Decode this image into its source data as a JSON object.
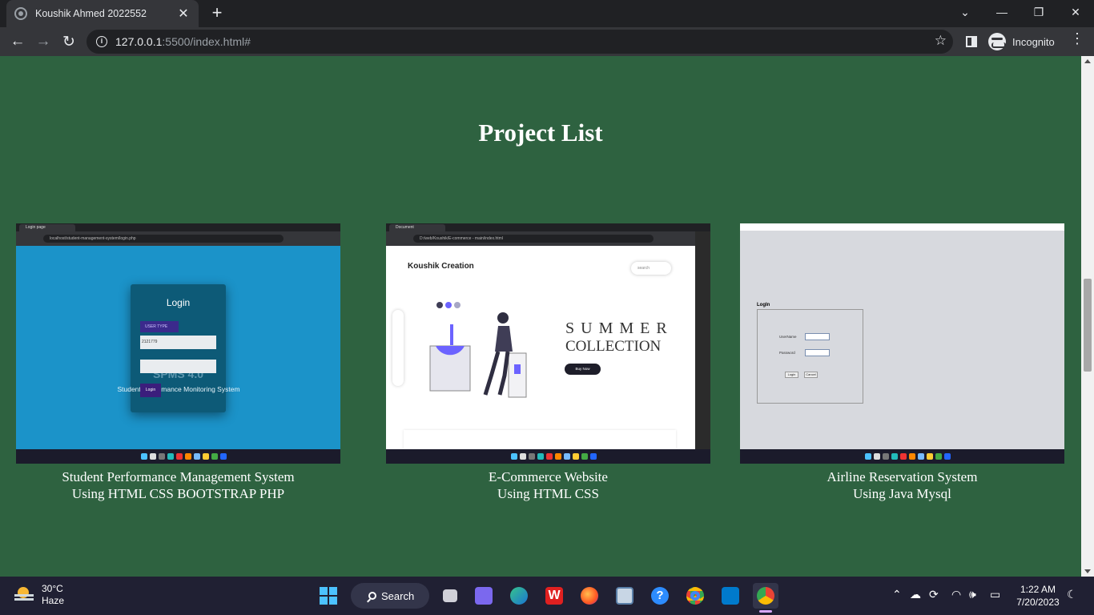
{
  "browser": {
    "tab_title": "Koushik Ahmed 2022552",
    "tab_close": "✕",
    "new_tab": "+",
    "url_host": "127.0.0.1",
    "url_path": ":5500/index.html#",
    "profile_label": "Incognito",
    "icons": [
      "back-icon",
      "forward-icon",
      "reload-icon",
      "info-icon",
      "star-icon",
      "side-panel-icon",
      "incognito-icon",
      "menu-icon"
    ]
  },
  "page": {
    "heading": "Project List",
    "projects": [
      {
        "title": "Student Performance Management System",
        "subtitle": "Using HTML CSS BOOTSTRAP PHP"
      },
      {
        "title": "E-Commerce Website",
        "subtitle": "Using HTML CSS"
      },
      {
        "title": "Airline Reservation System",
        "subtitle": "Using Java Mysql"
      }
    ]
  },
  "thumbnails": {
    "spms": {
      "tab": "Login page",
      "url": "localhost/student-management-system/login.php",
      "login_title": "Login",
      "user_type": "USER TYPE",
      "id_value": "2121779",
      "watermark": "SPMS 4.0",
      "subtitle": "Student Performance Monitoring System",
      "login_button": "Login"
    },
    "ecom": {
      "tab": "Document",
      "url": "D:/web/Koushik/E-commerce - main/index.html",
      "brand": "Koushik Creation",
      "search": "search",
      "summer": "SUMMER",
      "collection": "COLLECTION",
      "buy": "Buy Now"
    },
    "airline": {
      "login_label": "LogIn",
      "username_label": "UserName",
      "password_label": "Password",
      "login_button": "Login",
      "cancel_button": "Cancel"
    }
  },
  "taskbar": {
    "temperature": "30°C",
    "weather": "Haze",
    "search_label": "Search",
    "time": "1:22 AM",
    "date": "7/20/2023"
  },
  "colors": {
    "page_bg": "#2e6240",
    "thumb1_bg": "#1b93c9",
    "ecom_accent": "#6c63ff"
  }
}
